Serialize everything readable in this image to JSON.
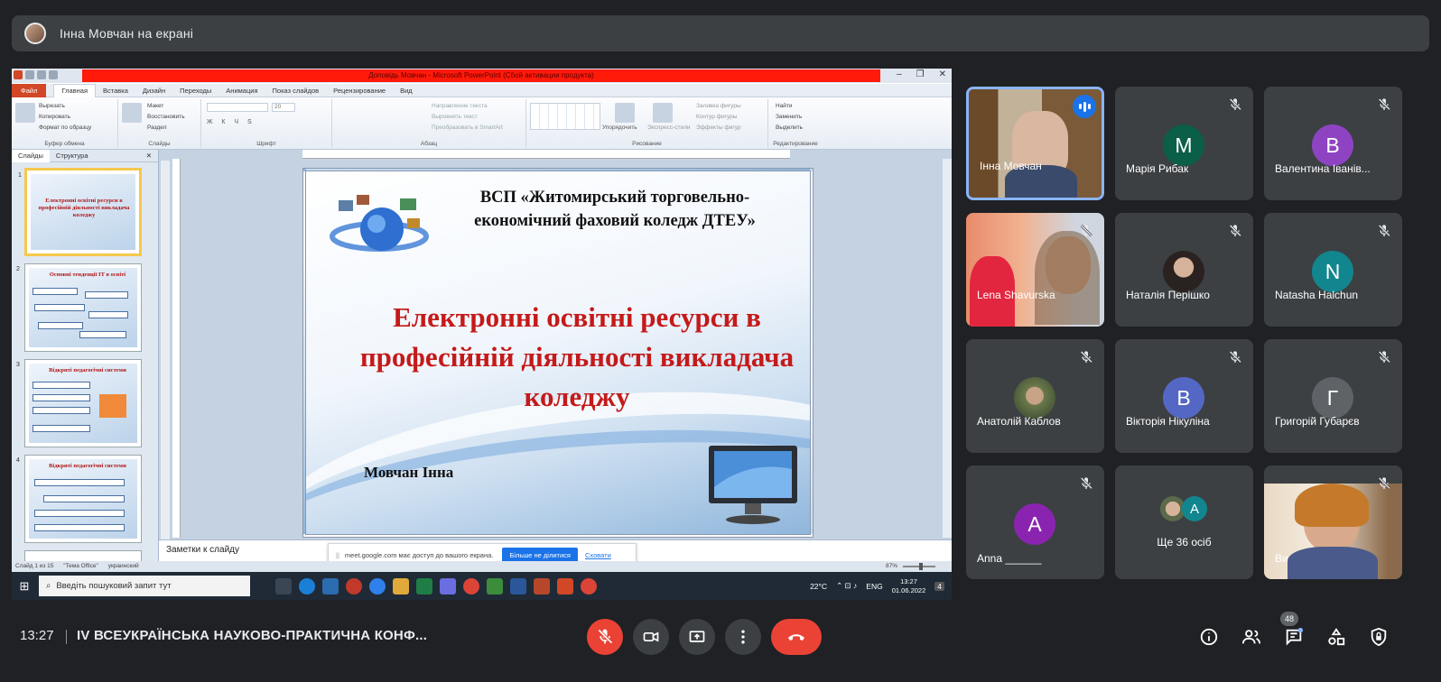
{
  "presenting_bar": {
    "text": "Інна Мовчан на екрані"
  },
  "powerpoint": {
    "window_title": "Доповідь Мовчан  -  Microsoft PowerPoint (Сбой активации продукта)",
    "tabs": [
      "Файл",
      "Главная",
      "Вставка",
      "Дизайн",
      "Переходы",
      "Анимация",
      "Показ слайдов",
      "Рецензирование",
      "Вид"
    ],
    "ribbon_groups": [
      {
        "caption": "Буфер обмена",
        "items": [
          "Вырезать",
          "Копировать",
          "Формат по образцу"
        ],
        "big": "Вставить"
      },
      {
        "caption": "Слайды",
        "items": [
          "Макет",
          "Восстановить",
          "Раздел"
        ],
        "big": "Создать слайд"
      },
      {
        "caption": "Шрифт",
        "items": [
          "",
          "",
          ""
        ]
      },
      {
        "caption": "Абзац",
        "items": [
          "Направление текста",
          "Выровнять текст",
          "Преобразовать в SmartArt"
        ]
      },
      {
        "caption": "Рисование",
        "items": [
          "Заливка фигуры",
          "Контур фигуры",
          "Эффекты фигур"
        ],
        "big": "Упорядочить",
        "big2": "Экспресс-стили"
      },
      {
        "caption": "Редактирование",
        "items": [
          "Найти",
          "Заменить",
          "Выделить"
        ]
      }
    ],
    "font_size": "20",
    "pane_tabs": [
      "Слайды",
      "Структура"
    ],
    "thumbnails": [
      {
        "num": "1",
        "title": "Електронні освітні ресурси в професійній діяльності викладача коледжу"
      },
      {
        "num": "2",
        "title": "Основні тенденції ІТ в освіті"
      },
      {
        "num": "3",
        "title": "Відкриті педагогічні системи"
      },
      {
        "num": "4",
        "title": "Відкриті педагогічні системи"
      }
    ],
    "slide": {
      "org": "ВСП «Житомирський торговельно-економічний фаховий коледж ДТЕУ»",
      "title": "Електронні освітні ресурси в професійній діяльності викладача коледжу",
      "author": "Мовчан Інна"
    },
    "notes_placeholder": "Заметки к слайду",
    "status": {
      "slide": "Слайд 1 из 15",
      "theme": "\"Тема Office\"",
      "lang": "украинский",
      "zoom": "87%",
      "zoom_fraction": 0.55
    },
    "share_banner": {
      "text": "meet.google.com має доступ до вашого екрана.",
      "stop": "Більше не ділитися",
      "hide": "Сховати"
    }
  },
  "taskbar": {
    "search_placeholder": "Введіть пошуковий запит тут",
    "weather": "22°C",
    "lang": "ENG",
    "time": "13:27",
    "date": "01.06.2022",
    "notif": "4"
  },
  "participants": [
    {
      "name": "Інна Мовчан",
      "initial": "",
      "color": "",
      "speaking": true
    },
    {
      "name": "Марія Рибак",
      "initial": "М",
      "color": "#0b5e47"
    },
    {
      "name": "Валентина Іванів...",
      "initial": "В",
      "color": "#8e44c2"
    },
    {
      "name": "Lena Shavurska",
      "initial": "",
      "color": ""
    },
    {
      "name": "Наталія Перішко",
      "initial": "",
      "color": ""
    },
    {
      "name": "Natasha Halchun",
      "initial": "N",
      "color": "#12868f"
    },
    {
      "name": "Анатолій Каблов",
      "initial": "",
      "color": ""
    },
    {
      "name": "Вікторія Нікуліна",
      "initial": "В",
      "color": "#5467c4"
    },
    {
      "name": "Григорій Губарєв",
      "initial": "Г",
      "color": "#5f6368"
    },
    {
      "name": "Anna ______",
      "initial": "A",
      "color": "#8a24b0"
    },
    {
      "name": "Ще 36 осіб",
      "initial": "A",
      "color": "#12868f"
    },
    {
      "name": "Ви",
      "initial": "",
      "color": ""
    }
  ],
  "bottom": {
    "time": "13:27",
    "meeting_title": "IV ВСЕУКРАЇНСЬКА НАУКОВО-ПРАКТИЧНА КОНФ...",
    "people_count": "48"
  }
}
